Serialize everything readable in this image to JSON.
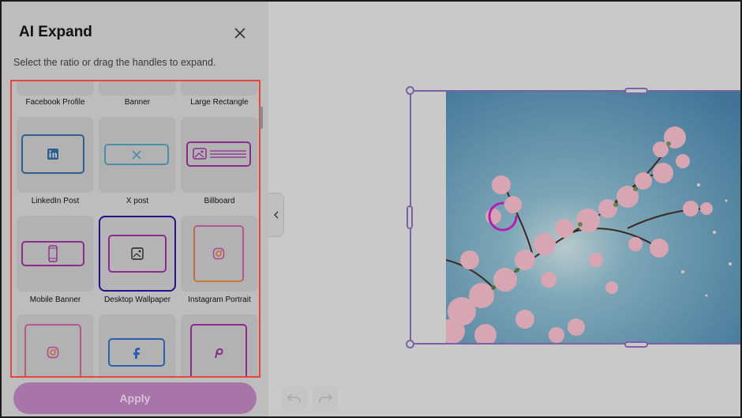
{
  "panel": {
    "title": "AI Expand",
    "subtitle": "Select the ratio or drag the handles to expand.",
    "apply_label": "Apply"
  },
  "ratios": [
    {
      "label": "Facebook Profile",
      "icon": "facebook-icon"
    },
    {
      "label": "Banner",
      "icon": "banner-icon"
    },
    {
      "label": "Large Rectangle",
      "icon": "rectangle-icon"
    },
    {
      "label": "LinkedIn Post",
      "icon": "linkedin-icon"
    },
    {
      "label": "X post",
      "icon": "x-icon"
    },
    {
      "label": "Billboard",
      "icon": "image-icon"
    },
    {
      "label": "Mobile Banner",
      "icon": "phone-icon"
    },
    {
      "label": "Desktop Wallpaper",
      "icon": "image-icon",
      "selected": true
    },
    {
      "label": "Instagram Portrait",
      "icon": "instagram-icon"
    },
    {
      "label": "",
      "icon": "instagram-icon"
    },
    {
      "label": "",
      "icon": "facebook-icon"
    },
    {
      "label": "",
      "icon": "pinterest-icon"
    }
  ],
  "colors": {
    "accent": "#a875a9",
    "selected_border": "#2a0f8a",
    "linkedin": "#2e5f8f",
    "x": "#4a8fa8",
    "billboard": "#8d2a8e",
    "frame": "#7a62a6",
    "highlight": "#e8453c"
  }
}
